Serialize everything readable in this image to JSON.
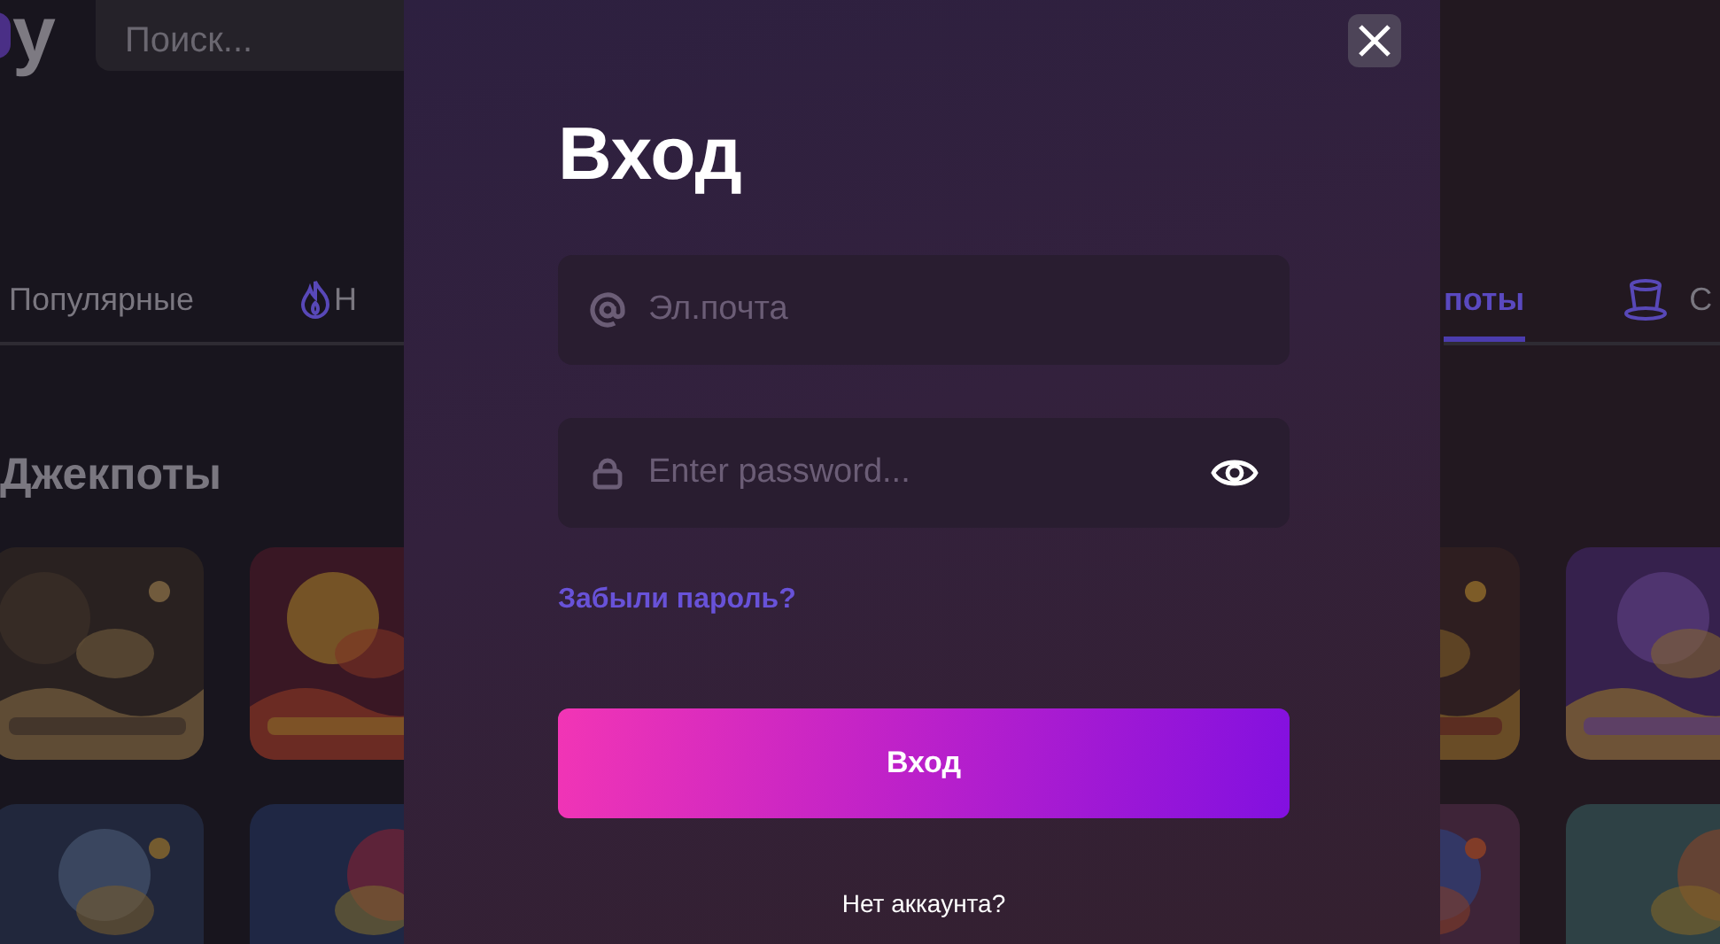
{
  "header": {
    "logo": "y",
    "search": {
      "placeholder": "Поиск..."
    }
  },
  "tabs": [
    {
      "label": "Популярные",
      "selected": false
    },
    {
      "label": "Н",
      "selected": false
    },
    {
      "label": "поты",
      "selected": true
    },
    {
      "label": "С",
      "selected": false
    }
  ],
  "section": {
    "title": "Джекпоты"
  },
  "modal": {
    "title": "Вход",
    "fields": [
      {
        "kind": "email",
        "placeholder": "Эл.почта"
      },
      {
        "kind": "password",
        "placeholder": "Enter password..."
      }
    ],
    "forgot_link": "Забыли пароль?",
    "submit": "Вход",
    "signup_prompt": "Нет аккаунта?"
  }
}
